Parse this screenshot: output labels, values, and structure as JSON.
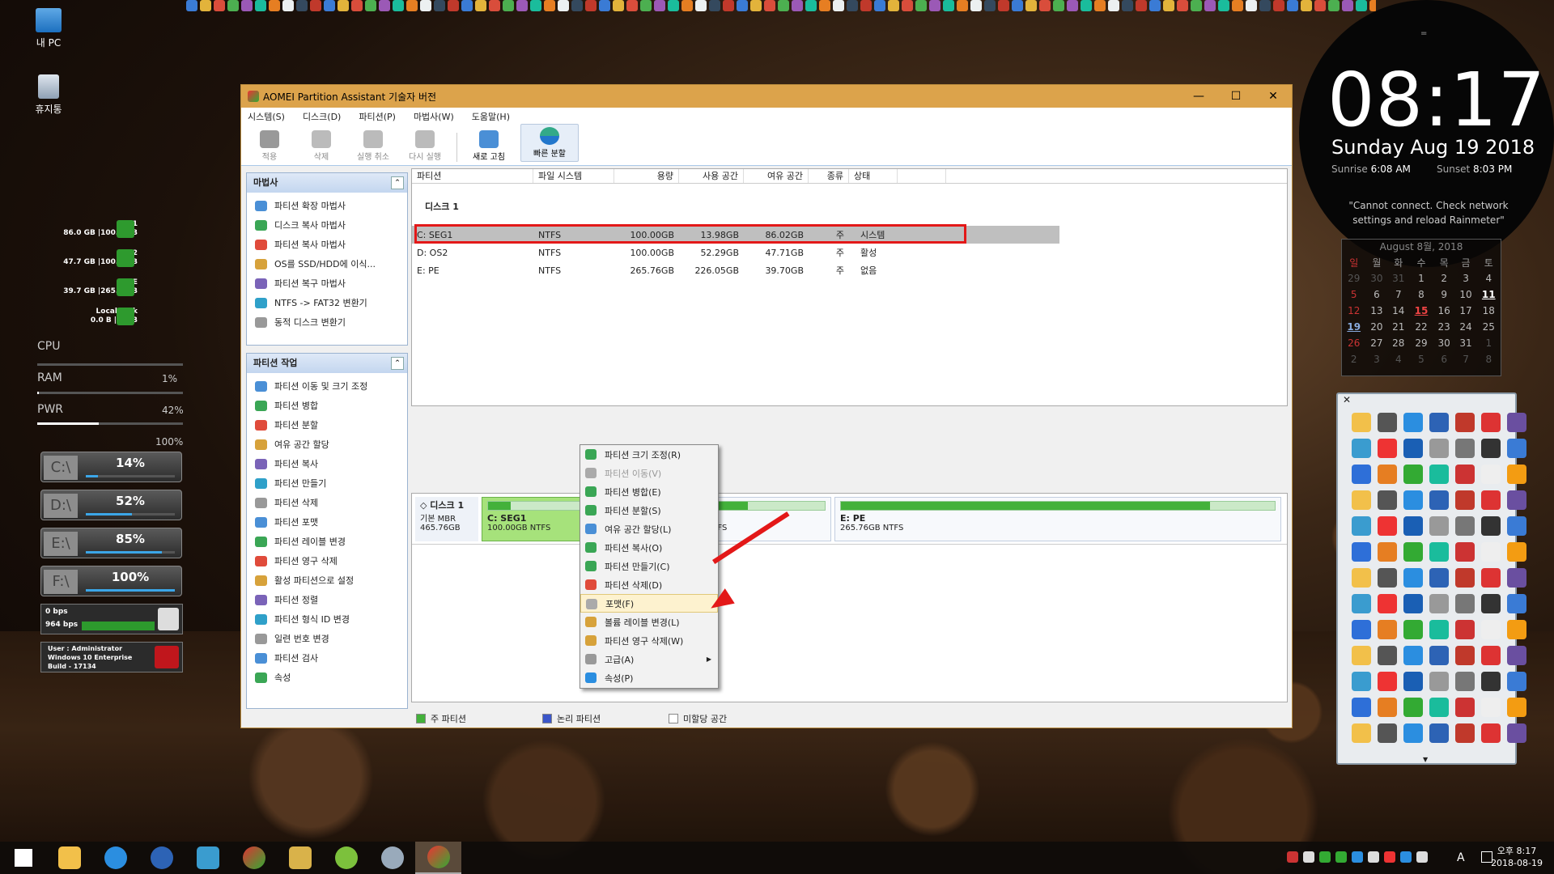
{
  "desktop": {
    "icons": [
      {
        "label": "내 PC"
      },
      {
        "label": "휴지통"
      }
    ]
  },
  "disk_gadget": [
    {
      "name": "SEG1",
      "size": "86.0 GB",
      "total": "|100.0 GB"
    },
    {
      "name": "OS2",
      "size": "47.7 GB",
      "total": "|100.0 GB"
    },
    {
      "name": "PE",
      "size": "39.7 GB",
      "total": "|265.8 GB"
    },
    {
      "name": "Local Disk",
      "size": "0.0 B",
      "total": "|0.0 B"
    }
  ],
  "system_meters": {
    "cpu_label": "CPU",
    "ram_label": "RAM",
    "ram_value": "1%",
    "ram_fraction": 0.01,
    "pwr_label": "PWR",
    "pwr_value": "42%",
    "pwr_fraction": 0.42,
    "extra": "100%"
  },
  "drives": [
    {
      "letter": "C:\\",
      "pct": "14%",
      "fraction": 0.14
    },
    {
      "letter": "D:\\",
      "pct": "52%",
      "fraction": 0.52
    },
    {
      "letter": "E:\\",
      "pct": "85%",
      "fraction": 0.85
    },
    {
      "letter": "F:\\",
      "pct": "100%",
      "fraction": 1.0
    }
  ],
  "network": {
    "up": "0 bps",
    "down": "964 bps"
  },
  "user_info": {
    "line1": "User : Administrator",
    "line2": "Windows 10 Enterprise",
    "line3": "Build - 17134"
  },
  "clock": {
    "time": "08:17",
    "date": "Sunday Aug 19 2018",
    "sunrise_label": "Sunrise",
    "sunrise": "6:08 AM",
    "sunset_label": "Sunset",
    "sunset": "8:03 PM",
    "message": "\"Cannot connect. Check network settings and reload Rainmeter\""
  },
  "calendar": {
    "title": "August 8월, 2018",
    "weekdays": [
      "월",
      "화",
      "수",
      "목",
      "금",
      "토"
    ],
    "rows": [
      [
        "29",
        "30",
        "31",
        "1",
        "2",
        "3",
        "4"
      ],
      [
        "5",
        "6",
        "7",
        "8",
        "9",
        "10",
        "11"
      ],
      [
        "12",
        "13",
        "14",
        "15",
        "16",
        "17",
        "18"
      ],
      [
        "19",
        "20",
        "21",
        "22",
        "23",
        "24",
        "25"
      ],
      [
        "26",
        "27",
        "28",
        "29",
        "30",
        "31",
        "1"
      ],
      [
        "2",
        "3",
        "4",
        "5",
        "6",
        "7",
        "8"
      ]
    ]
  },
  "window": {
    "title": "AOMEI Partition Assistant 기술자 버전",
    "controls": [
      "—",
      "☐",
      "✕"
    ]
  },
  "menu": [
    "시스템(S)",
    "디스크(D)",
    "파티션(P)",
    "마법사(W)",
    "도움말(H)"
  ],
  "toolbar": [
    {
      "label": "적용",
      "icon": "check-icon"
    },
    {
      "label": "삭제",
      "icon": "discard-icon"
    },
    {
      "label": "실행 취소",
      "icon": "undo-icon"
    },
    {
      "label": "다시 실행",
      "icon": "redo-icon"
    },
    {
      "label": "새로 고침",
      "icon": "refresh-icon"
    },
    {
      "label": "빠른 분할",
      "icon": "quick-partition-icon"
    }
  ],
  "wizard_panel": {
    "title": "마법사",
    "collapse": "⌃",
    "items": [
      "파티션 확장 마법사",
      "디스크 복사 마법사",
      "파티션 복사 마법사",
      "OS를 SSD/HDD에 이식...",
      "파티션 복구 마법사",
      "NTFS -> FAT32 변환기",
      "동적 디스크 변환기"
    ]
  },
  "ops_panel": {
    "title": "파티션 작업",
    "collapse": "⌃",
    "items": [
      "파티션 이동 및 크기 조정",
      "파티션 병합",
      "파티션 분할",
      "여유 공간 할당",
      "파티션 복사",
      "파티션 만들기",
      "파티션 삭제",
      "파티션 포맷",
      "파티션 레이블 변경",
      "파티션 영구 삭제",
      "활성 파티션으로 설정",
      "파티션 정렬",
      "파티션 형식 ID 변경",
      "일련 번호 변경",
      "파티션 검사",
      "속성"
    ]
  },
  "table": {
    "headers": [
      "파티션",
      "파일 시스템",
      "용량",
      "사용 공간",
      "여유 공간",
      "종류",
      "상태"
    ],
    "disk_label": "디스크 1",
    "rows": [
      [
        "C: SEG1",
        "NTFS",
        "100.00GB",
        "13.98GB",
        "86.02GB",
        "주",
        "시스템"
      ],
      [
        "D: OS2",
        "NTFS",
        "100.00GB",
        "52.29GB",
        "47.71GB",
        "주",
        "활성"
      ],
      [
        "E: PE",
        "NTFS",
        "265.76GB",
        "226.05GB",
        "39.70GB",
        "주",
        "없음"
      ]
    ]
  },
  "disk_map": {
    "name": "디스크 1",
    "type": "기본 MBR",
    "size": "465.76GB",
    "partitions": [
      {
        "name": "C: SEG1",
        "info": "100.00GB NTFS",
        "used_fraction": 0.14
      },
      {
        "name": "D: OS2",
        "info": "100.00GB NTFS",
        "used_fraction": 0.52
      },
      {
        "name": "E: PE",
        "info": "265.76GB NTFS",
        "used_fraction": 0.85
      }
    ]
  },
  "legend": [
    "주 파티션",
    "논리 파티션",
    "미할당 공간"
  ],
  "context_menu": [
    {
      "label": "파티션 크기 조정(R)",
      "enabled": true
    },
    {
      "label": "파티션 이동(V)",
      "enabled": false
    },
    {
      "label": "파티션 병합(E)",
      "enabled": true
    },
    {
      "label": "파티션 분할(S)",
      "enabled": true
    },
    {
      "label": "여유 공간 할당(L)",
      "enabled": true
    },
    {
      "label": "파티션 복사(O)",
      "enabled": true
    },
    {
      "label": "파티션 만들기(C)",
      "enabled": true
    },
    {
      "label": "파티션 삭제(D)",
      "enabled": true
    },
    {
      "label": "포맷(F)",
      "enabled": true,
      "selected": true
    },
    {
      "label": "볼륨 레이블 변경(L)",
      "enabled": true
    },
    {
      "label": "파티션 영구 삭제(W)",
      "enabled": true
    },
    {
      "label": "고급(A)",
      "enabled": true,
      "submenu": true
    },
    {
      "label": "속성(P)",
      "enabled": true
    }
  ],
  "tray": {
    "time": "오후 8:17",
    "date": "2018-08-19",
    "ime": "A"
  },
  "colors": {
    "title_bar": "#dca34b",
    "accent_blue": "#3ba6e8",
    "primary_partition": "#43b13a",
    "highlight_red": "#e31818"
  }
}
